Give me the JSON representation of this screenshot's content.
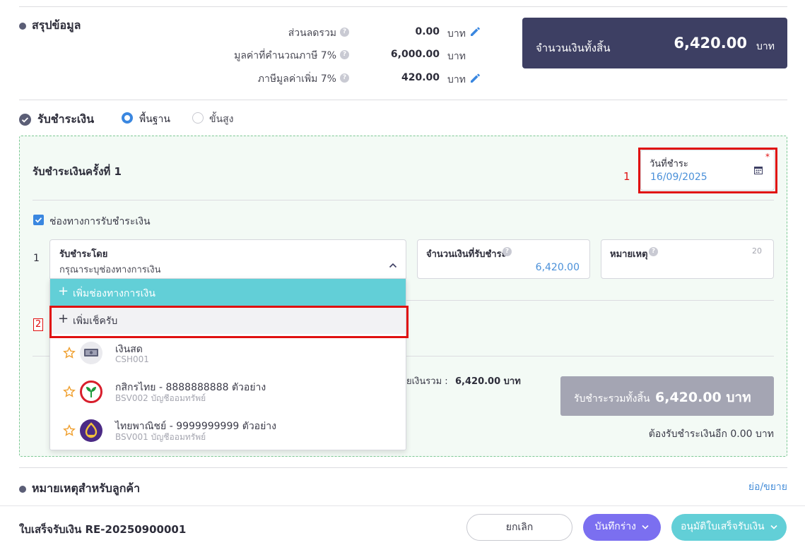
{
  "summary": {
    "title": "สรุปข้อมูล",
    "rows": [
      {
        "label": "ส่วนลดรวม",
        "value": "0.00",
        "unit": "บาท"
      },
      {
        "label": "มูลค่าที่คำนวณภาษี 7%",
        "value": "6,000.00",
        "unit": "บาท"
      },
      {
        "label": "ภาษีมูลค่าเพิ่ม 7%",
        "value": "420.00",
        "unit": "บาท"
      }
    ],
    "total_label": "จำนวนเงินทั้งสิ้น",
    "total_value": "6,420.00",
    "total_unit": "บาท"
  },
  "payment": {
    "title": "รับชำระเงิน",
    "mode_basic": "พื้นฐาน",
    "mode_advanced": "ขั้นสูง",
    "selected_mode": "basic",
    "installment_title": "รับชำระเงินครั้งที่ 1",
    "date_label": "วันที่ชำระ",
    "date_value": "16/09/2025",
    "required_mark": "*",
    "annotation_1": "1",
    "annotation_2": "2",
    "channel_checkbox_label": "ช่องทางการรับชำระเงิน",
    "row_number": "1",
    "pay_by_label": "รับชำระโดย",
    "pay_by_placeholder": "กรุณาระบุช่องทางการเงิน",
    "amount_label": "จำนวนเงินที่รับชำระ",
    "amount_value": "6,420.00",
    "note_label": "หมายเหตุ",
    "note_counter": "20",
    "dropdown": {
      "add_channel": "เพิ่มช่องทางการเงิน",
      "add_cheque": "เพิ่มเช็ครับ",
      "options": [
        {
          "title": "เงินสด",
          "code": "CSH001",
          "icon": "cash-icon"
        },
        {
          "title": "กสิกรไทย - 8888888888 ตัวอย่าง",
          "code": "BSV002 บัญชีออมทรัพย์",
          "icon": "kbank-logo-icon"
        },
        {
          "title": "ไทยพาณิชย์ - 9999999999 ตัวอย่าง",
          "code": "BSV001 บัญชีออมทรัพย์",
          "icon": "scb-logo-icon"
        }
      ]
    },
    "partial_total_text": "ยเงินรวม :",
    "partial_total_value": "6,420.00 บาท",
    "grand_label": "รับชำระรวมทั้งสิ้น",
    "grand_value": "6,420.00 บาท",
    "remaining_text": "ต้องรับชำระเงินอีก 0.00 บาท"
  },
  "customer_note": {
    "title": "หมายเหตุสำหรับลูกค้า",
    "toggle": "ย่อ/ขยาย"
  },
  "footer": {
    "doc_title": "ใบเสร็จรับเงิน RE-20250900001",
    "cancel": "ยกเลิก",
    "save_draft": "บันทึกร่าง",
    "approve": "อนุมัติใบเสร็จรับเงิน"
  },
  "colors": {
    "primary": "#3d3f63",
    "teal": "#62cfd7",
    "purple": "#7b6ff0",
    "blue_text": "#4a90d9",
    "annotation_red": "#e01010",
    "panel_bg": "#f3faf5"
  }
}
